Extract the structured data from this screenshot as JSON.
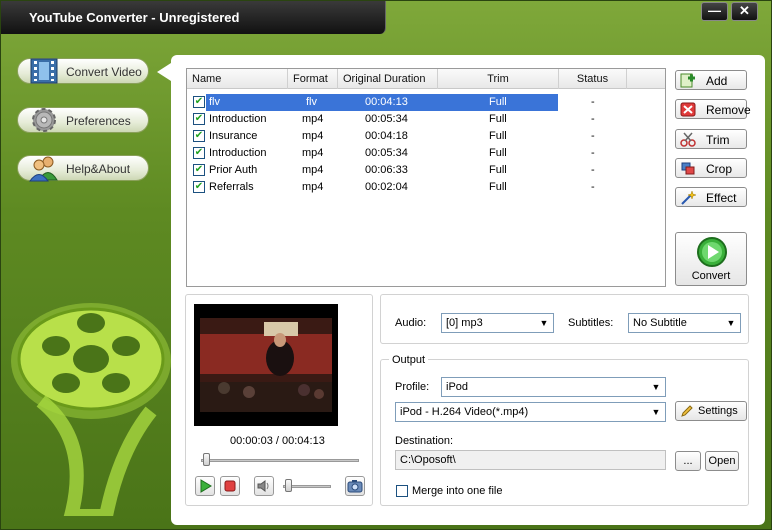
{
  "window": {
    "title": "YouTube Converter - Unregistered",
    "minimize_label": "—",
    "close_label": "✕"
  },
  "nav": {
    "items": [
      {
        "label": "Convert Video",
        "icon": "film-icon"
      },
      {
        "label": "Preferences",
        "icon": "gear-icon"
      },
      {
        "label": "Help&About",
        "icon": "users-icon"
      }
    ]
  },
  "filelist": {
    "headers": [
      "Name",
      "Format",
      "Original Duration",
      "Trim",
      "Status"
    ],
    "rows": [
      {
        "name": "flv",
        "format": "flv",
        "duration": "00:04:13",
        "trim": "Full",
        "status": "-",
        "checked": true,
        "selected": true
      },
      {
        "name": "Introduction",
        "format": "mp4",
        "duration": "00:05:34",
        "trim": "Full",
        "status": "-",
        "checked": true,
        "selected": false
      },
      {
        "name": "Insurance",
        "format": "mp4",
        "duration": "00:04:18",
        "trim": "Full",
        "status": "-",
        "checked": true,
        "selected": false
      },
      {
        "name": "Introduction",
        "format": "mp4",
        "duration": "00:05:34",
        "trim": "Full",
        "status": "-",
        "checked": true,
        "selected": false
      },
      {
        "name": "Prior Auth",
        "format": "mp4",
        "duration": "00:06:33",
        "trim": "Full",
        "status": "-",
        "checked": true,
        "selected": false
      },
      {
        "name": "Referrals",
        "format": "mp4",
        "duration": "00:02:04",
        "trim": "Full",
        "status": "-",
        "checked": true,
        "selected": false
      }
    ]
  },
  "actions": {
    "add": "Add",
    "remove": "Remove",
    "trim": "Trim",
    "crop": "Crop",
    "effect": "Effect",
    "convert": "Convert"
  },
  "preview": {
    "time": "00:00:03 / 00:04:13",
    "progress": 0.012,
    "volume": 0.05
  },
  "settings": {
    "audio_label": "Audio:",
    "audio_value": "[0] mp3",
    "subtitles_label": "Subtitles:",
    "subtitles_value": "No Subtitle",
    "output_label": "Output",
    "profile_label": "Profile:",
    "profile_value": "iPod",
    "format_value": "iPod - H.264 Video(*.mp4)",
    "settings_btn": "Settings",
    "destination_label": "Destination:",
    "destination_value": "C:\\Oposoft\\",
    "browse_btn": "...",
    "open_btn": "Open",
    "merge_label": "Merge into one file",
    "merge_checked": false
  },
  "colors": {
    "selection": "#3a74d8",
    "frame_green": "#5e8a22",
    "check_green": "#21a121"
  }
}
